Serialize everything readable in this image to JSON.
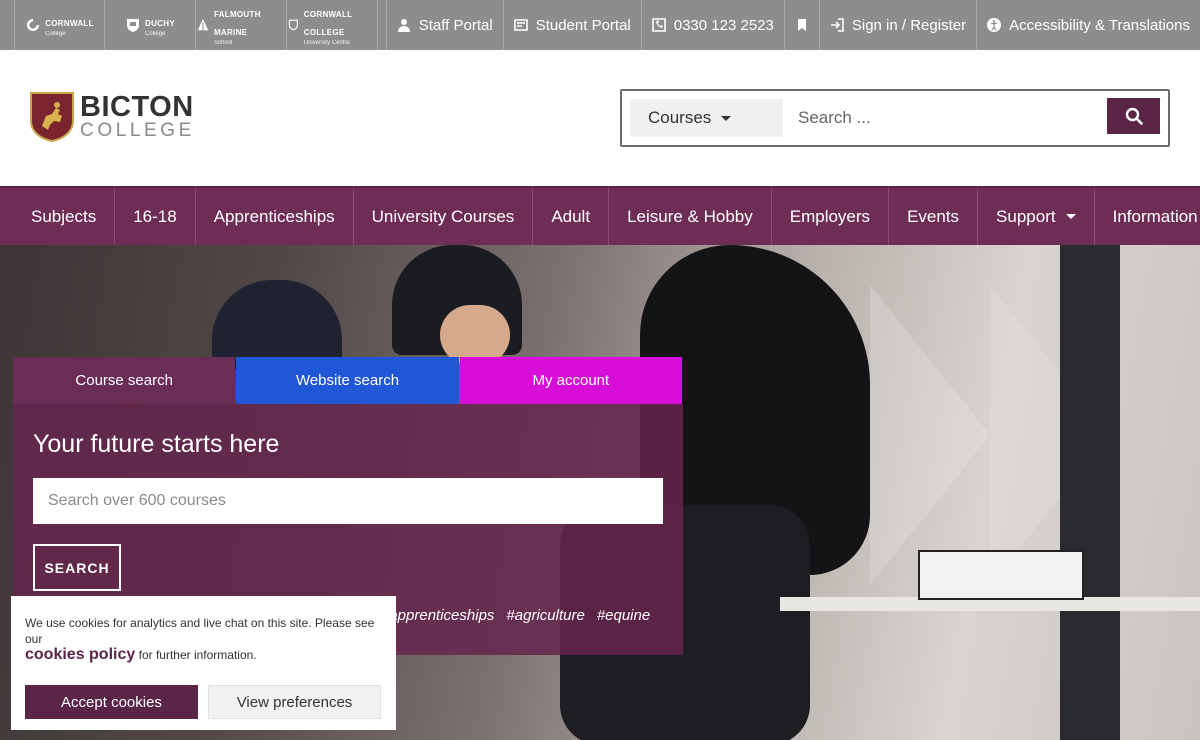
{
  "topbar": {
    "brands": [
      {
        "icon": "cornwall-college-logo-icon",
        "name": "Cornwall",
        "sub": "College"
      },
      {
        "icon": "duchy-college-logo-icon",
        "name": "Duchy",
        "sub": "College"
      },
      {
        "icon": "falmouth-marine-school-logo-icon",
        "name": "Falmouth Marine",
        "sub": "School"
      },
      {
        "icon": "cornwall-college-university-centre-logo-icon",
        "name": "Cornwall College",
        "sub": "University Centre"
      }
    ],
    "links": [
      {
        "icon": "user-icon",
        "label": "Staff Portal"
      },
      {
        "icon": "student-id-icon",
        "label": "Student Portal"
      },
      {
        "icon": "phone-icon",
        "label": "0330 123 2523"
      },
      {
        "icon": "bookmark-icon",
        "label": ""
      },
      {
        "icon": "sign-in-icon",
        "label": "Sign in / Register"
      },
      {
        "icon": "accessibility-icon",
        "label": "Accessibility & Translations"
      }
    ]
  },
  "header": {
    "logo_line1": "BICTON",
    "logo_line2": "COLLEGE",
    "search": {
      "scope": "Courses",
      "placeholder": "Search ..."
    }
  },
  "nav": {
    "items": [
      {
        "label": "Subjects"
      },
      {
        "label": "16-18"
      },
      {
        "label": "Apprenticeships"
      },
      {
        "label": "University Courses"
      },
      {
        "label": "Adult"
      },
      {
        "label": "Leisure & Hobby"
      },
      {
        "label": "Employers"
      },
      {
        "label": "Events"
      },
      {
        "label": "Support"
      },
      {
        "label": "Information"
      }
    ]
  },
  "hero": {
    "tabs": {
      "course": "Course search",
      "website": "Website search",
      "account": "My account"
    },
    "title": "Your future starts here",
    "course_placeholder": "Search over 600 courses",
    "search_button": "SEARCH",
    "tags": [
      "#apprenticeships",
      "#agriculture",
      "#equine"
    ]
  },
  "cookie": {
    "text_before": "We use cookies for analytics and live chat on this site. Please see our",
    "link": "cookies policy",
    "text_after": "for further information.",
    "accept": "Accept cookies",
    "preferences": "View preferences"
  },
  "colors": {
    "brand_purple": "#6d2d55",
    "button_purple": "#5a2547",
    "website_tab": "#1f57d6",
    "account_tab": "#d70ed7",
    "topbar": "#8d8d8d"
  }
}
